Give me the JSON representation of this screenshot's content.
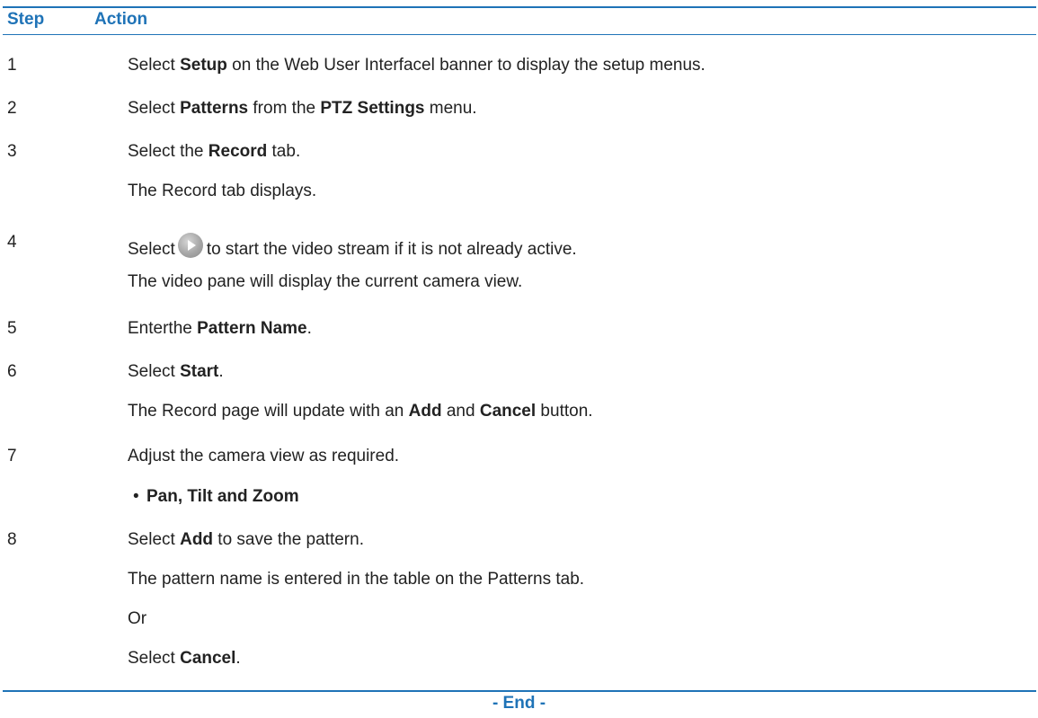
{
  "header": {
    "step": "Step",
    "action": "Action"
  },
  "steps": [
    {
      "num": "1",
      "lines": [
        {
          "parts": [
            "Select ",
            "Setup",
            " on the Web User Interfacel banner to display the setup menus."
          ]
        }
      ]
    },
    {
      "num": "2",
      "lines": [
        {
          "parts": [
            "Select ",
            "Patterns",
            " from the ",
            "PTZ Settings",
            " menu."
          ]
        }
      ]
    },
    {
      "num": "3",
      "lines": [
        {
          "parts": [
            "Select the ",
            "Record",
            " tab."
          ]
        },
        {
          "text": "The Record tab displays."
        }
      ]
    },
    {
      "num": "4",
      "lines": [
        {
          "before": "Select",
          "icon": "play-icon",
          "after": "to start the video stream if it is not already active."
        },
        {
          "text": "The video pane will display the current camera view."
        }
      ]
    },
    {
      "num": "5",
      "lines": [
        {
          "parts": [
            "Enterthe ",
            "Pattern Name",
            "."
          ]
        }
      ]
    },
    {
      "num": "6",
      "lines": [
        {
          "parts": [
            "Select ",
            "Start",
            "."
          ]
        },
        {
          "parts": [
            "The Record page will update with an ",
            "Add",
            " and ",
            "Cancel",
            " button."
          ]
        }
      ]
    },
    {
      "num": "7",
      "lines": [
        {
          "text": "Adjust the camera view as required."
        },
        {
          "bullet": "•",
          "text": "Pan, Tilt and Zoom"
        }
      ]
    },
    {
      "num": "8",
      "lines": [
        {
          "parts": [
            "Select ",
            "Add",
            " to save the pattern."
          ]
        },
        {
          "text": "The pattern name is entered in the table on the Patterns tab."
        },
        {
          "text": "Or"
        },
        {
          "parts": [
            "Select ",
            "Cancel",
            "."
          ]
        }
      ]
    }
  ],
  "footer": {
    "end": "- End -"
  },
  "colors": {
    "accent": "#1f73b7",
    "text": "#222222"
  }
}
